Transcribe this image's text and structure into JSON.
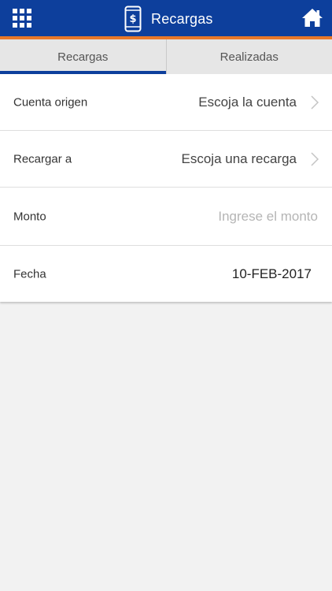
{
  "header": {
    "title": "Recargas",
    "menu_icon": "grid-menu-icon",
    "title_icon": "phone-dollar-icon",
    "home_icon": "home-icon",
    "colors": {
      "bar": "#0d3f9c",
      "accent": "#e8782a"
    }
  },
  "tabs": [
    {
      "label": "Recargas",
      "active": true
    },
    {
      "label": "Realizadas",
      "active": false
    }
  ],
  "form": {
    "cuenta_origen": {
      "label": "Cuenta origen",
      "value": "Escoja la cuenta"
    },
    "recargar_a": {
      "label": "Recargar a",
      "value": "Escoja una recarga"
    },
    "monto": {
      "label": "Monto",
      "placeholder": "Ingrese el monto"
    },
    "fecha": {
      "label": "Fecha",
      "value": "10-FEB-2017"
    }
  }
}
